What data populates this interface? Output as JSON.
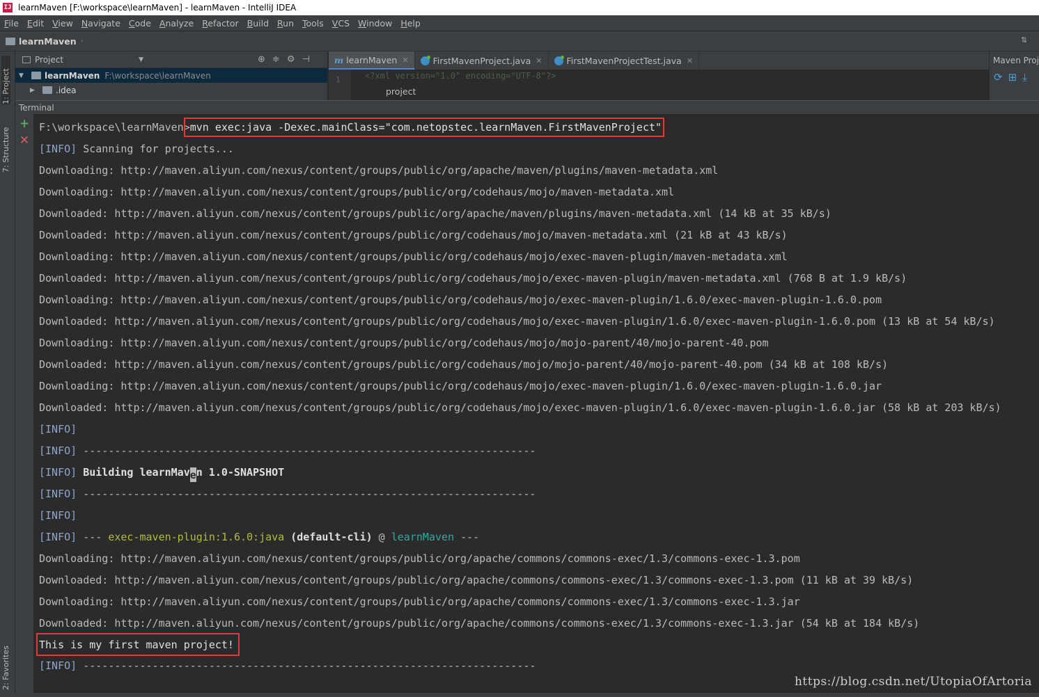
{
  "window": {
    "title": "learnMaven [F:\\workspace\\learnMaven] - learnMaven - IntelliJ IDEA",
    "app_icon": "IJ"
  },
  "menu": [
    "File",
    "Edit",
    "View",
    "Navigate",
    "Code",
    "Analyze",
    "Refactor",
    "Build",
    "Run",
    "Tools",
    "VCS",
    "Window",
    "Help"
  ],
  "navbar": {
    "crumb": "learnMaven"
  },
  "side_tabs": {
    "project": "1: Project",
    "structure": "7: Structure",
    "favorites": "2: Favorites"
  },
  "project_panel": {
    "title": "Project",
    "tree": [
      {
        "name": "learnMaven",
        "path": "F:\\workspace\\learnMaven"
      },
      {
        "name": ".idea",
        "path": ""
      }
    ]
  },
  "editor": {
    "tabs": [
      "learnMaven",
      "FirstMavenProject.java",
      "FirstMavenProjectTest.java"
    ],
    "gutter_line": "1",
    "code_fragment": "<?xml version=\"1.0\" encoding=\"UTF-8\"?>",
    "breadcrumb": "project"
  },
  "maven_panel": {
    "title": "Maven Projects"
  },
  "terminal": {
    "title": "Terminal",
    "prompt": "F:\\workspace\\learnMaven>",
    "command": "mvn exec:java -Dexec.mainClass=\"com.netopstec.learnMaven.FirstMavenProject\"",
    "info_tag": "[INFO]",
    "scanning": " Scanning for projects...",
    "dashes": " ------------------------------------------------------------------------",
    "building_a": " Building learnMav",
    "building_cursor": "e",
    "building_b": "n 1.0-SNAPSHOT",
    "plugin_prefix": " --- ",
    "plugin_name": "exec-maven-plugin:1.6.0:java",
    "plugin_cli": " (default-cli)",
    "plugin_at": " @ ",
    "plugin_artifact": "learnMaven",
    "plugin_suffix": " ---",
    "downloads_a": [
      "Downloading: http://maven.aliyun.com/nexus/content/groups/public/org/apache/maven/plugins/maven-metadata.xml",
      "Downloading: http://maven.aliyun.com/nexus/content/groups/public/org/codehaus/mojo/maven-metadata.xml",
      "Downloaded: http://maven.aliyun.com/nexus/content/groups/public/org/apache/maven/plugins/maven-metadata.xml (14 kB at 35 kB/s)",
      "Downloaded: http://maven.aliyun.com/nexus/content/groups/public/org/codehaus/mojo/maven-metadata.xml (21 kB at 43 kB/s)",
      "Downloading: http://maven.aliyun.com/nexus/content/groups/public/org/codehaus/mojo/exec-maven-plugin/maven-metadata.xml",
      "Downloaded: http://maven.aliyun.com/nexus/content/groups/public/org/codehaus/mojo/exec-maven-plugin/maven-metadata.xml (768 B at 1.9 kB/s)",
      "Downloading: http://maven.aliyun.com/nexus/content/groups/public/org/codehaus/mojo/exec-maven-plugin/1.6.0/exec-maven-plugin-1.6.0.pom",
      "Downloaded: http://maven.aliyun.com/nexus/content/groups/public/org/codehaus/mojo/exec-maven-plugin/1.6.0/exec-maven-plugin-1.6.0.pom (13 kB at 54 kB/s)",
      "Downloading: http://maven.aliyun.com/nexus/content/groups/public/org/codehaus/mojo/mojo-parent/40/mojo-parent-40.pom",
      "Downloaded: http://maven.aliyun.com/nexus/content/groups/public/org/codehaus/mojo/mojo-parent/40/mojo-parent-40.pom (34 kB at 108 kB/s)",
      "Downloading: http://maven.aliyun.com/nexus/content/groups/public/org/codehaus/mojo/exec-maven-plugin/1.6.0/exec-maven-plugin-1.6.0.jar",
      "Downloaded: http://maven.aliyun.com/nexus/content/groups/public/org/codehaus/mojo/exec-maven-plugin/1.6.0/exec-maven-plugin-1.6.0.jar (58 kB at 203 kB/s)"
    ],
    "downloads_b": [
      "Downloading: http://maven.aliyun.com/nexus/content/groups/public/org/apache/commons/commons-exec/1.3/commons-exec-1.3.pom",
      "Downloaded: http://maven.aliyun.com/nexus/content/groups/public/org/apache/commons/commons-exec/1.3/commons-exec-1.3.pom (11 kB at 39 kB/s)",
      "Downloading: http://maven.aliyun.com/nexus/content/groups/public/org/apache/commons/commons-exec/1.3/commons-exec-1.3.jar",
      "Downloaded: http://maven.aliyun.com/nexus/content/groups/public/org/apache/commons/commons-exec/1.3/commons-exec-1.3.jar (54 kB at 184 kB/s)"
    ],
    "program_output": "This is my first maven project!"
  },
  "watermark": "https://blog.csdn.net/UtopiaOfArtoria",
  "colors": {
    "highlight_box": "#e53935",
    "info": "#8fa6c9",
    "plugin": "#b5b93e",
    "artifact": "#36a6a1",
    "background": "#2b2b2b"
  }
}
